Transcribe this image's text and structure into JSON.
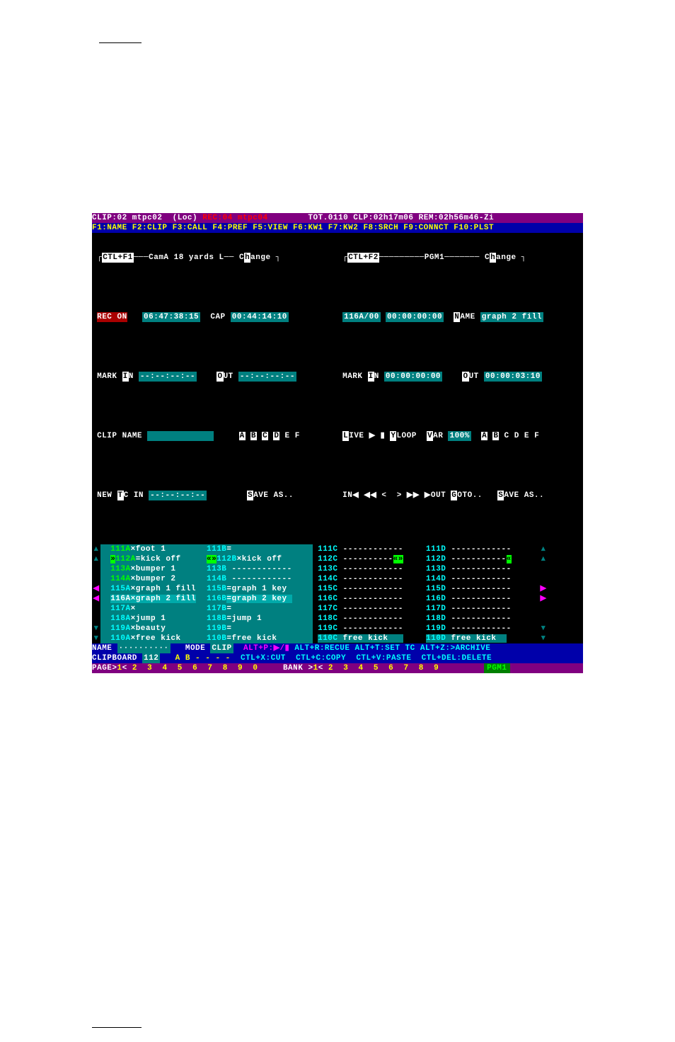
{
  "header": {
    "clip_left": "CLIP:02 mtpc02  (Loc)",
    "rec_right": "REC:04 mtpc04",
    "tot": "TOT.0110",
    "clp": "CLP:02h17m06",
    "rem": "REM:02h56m46-Zi"
  },
  "fkeys": "F1:NAME F2:CLIP F3:CALL F4:PREF F5:VIEW F6:KW1 F7:KW2 F8:SRCH F9:CONNCT F10:PLST",
  "panelL": {
    "hotkey": "CTL+F1",
    "title": "CamA 18 yards L",
    "change": "Change",
    "rec": "REC ON",
    "rec_tc": "06:47:38:15",
    "cap": "CAP",
    "cap_tc": "00:44:14:10",
    "mark_in": "MARK IN",
    "mark_in_tc": "--:--:--:--",
    "out": "OUT",
    "out_tc": "--:--:--:--",
    "clip_name": "CLIP NAME",
    "clip_name_val": "",
    "abc": "A B C D E F",
    "new_tc": "NEW TC IN",
    "new_tc_val": "--:--:--:--",
    "save": "SAVE AS.."
  },
  "panelR": {
    "hotkey": "CTL+F2",
    "title": "PGM1",
    "change": "Change",
    "id": "116A/00",
    "id_tc": "00:00:00:00",
    "name": "NAME",
    "name_val": "graph 2 fill",
    "mark_in": "MARK IN",
    "mark_in_tc": "00:00:00:00",
    "out": "OUT",
    "out_tc": "00:00:03:10",
    "live": "LIVE ▶ ▮",
    "yloop": "YLOOP",
    "var": "VAR",
    "var_val": "100%",
    "abc": "A B C D E F",
    "in_nav": "IN◀ ◀◀ <  > ▶▶ ▶OUT",
    "goto": "GOTO..",
    "save": "SAVE AS.."
  },
  "clips": [
    {
      "a": "111A",
      "an": "foot 1",
      "b": "111B",
      "bn": "=",
      "c": "111C",
      "cn": "------------",
      "d": "111D",
      "dn": "------------",
      "la": "▴",
      "ra": "▴",
      "ahl": true
    },
    {
      "a": "112A",
      "an": "kick off",
      "b": "112B",
      "bn": "kick off",
      "c": "112C",
      "cn": "------------",
      "d": "112D",
      "dn": "------------",
      "la": "▴",
      "ra": "▴",
      "ahl": true,
      "rowhl": true,
      "gmark": true
    },
    {
      "a": "113A",
      "an": "bumper 1",
      "b": "113B",
      "bn": "------------",
      "c": "113C",
      "cn": "------------",
      "d": "113D",
      "dn": "------------",
      "ahl": true
    },
    {
      "a": "114A",
      "an": "bumper 2",
      "b": "114B",
      "bn": "------------",
      "c": "114C",
      "cn": "------------",
      "d": "114D",
      "dn": "------------",
      "ahl": true
    },
    {
      "a": "115A",
      "an": "graph 1 fill",
      "b": "115B",
      "bn": "graph 1 key",
      "c": "115C",
      "cn": "------------",
      "d": "115D",
      "dn": "------------",
      "la": "◀",
      "ra": "▶",
      "lac": "m",
      "rac": "m"
    },
    {
      "a": "116A",
      "an": "graph 2 fill",
      "b": "116B",
      "bn": "graph 2 key",
      "c": "116C",
      "cn": "------------",
      "d": "116D",
      "dn": "------------",
      "la": "◀",
      "ra": "▶",
      "lac": "m",
      "rac": "m",
      "sel": true
    },
    {
      "a": "117A",
      "an": "",
      "b": "117B",
      "bn": "=",
      "c": "117C",
      "cn": "------------",
      "d": "117D",
      "dn": "------------"
    },
    {
      "a": "118A",
      "an": "jump 1",
      "b": "118B",
      "bn": "jump 1",
      "c": "118C",
      "cn": "------------",
      "d": "118D",
      "dn": "------------"
    },
    {
      "a": "119A",
      "an": "beauty",
      "b": "119B",
      "bn": "=",
      "c": "119C",
      "cn": "------------",
      "d": "119D",
      "dn": "------------",
      "la": "▾",
      "ra": "▾"
    },
    {
      "a": "110A",
      "an": "free kick",
      "b": "110B",
      "bn": "free kick",
      "c": "110C",
      "cn": "free kick",
      "d": "110D",
      "dn": "free kick",
      "la": "▾",
      "ra": "▾",
      "teal": true
    }
  ],
  "footer": {
    "name": "NAME",
    "name_val": "··········",
    "mode": "MODE",
    "mode_val": "CLIP",
    "altp": "ALT+P:▶/▮",
    "altr": "ALT+R:RECUE",
    "altt": "ALT+T:SET TC",
    "altz": "ALT+Z:>ARCHIVE",
    "clipboard": "CLIPBOARD",
    "clipboard_val": "112",
    "ab": "A B - - - -",
    "ctlx": "CTL+X:CUT",
    "ctlc": "CTL+C:COPY",
    "ctlv": "CTL+V:PASTE",
    "ctldel": "CTL+DEL:DELETE",
    "page": "PAGE",
    "pages": [
      "1",
      "2",
      "3",
      "4",
      "5",
      "6",
      "7",
      "8",
      "9",
      "0"
    ],
    "bank": "BANK",
    "banks": [
      "1",
      "2",
      "3",
      "4",
      "5",
      "6",
      "7",
      "8",
      "9"
    ],
    "pgm": "PGM1"
  }
}
